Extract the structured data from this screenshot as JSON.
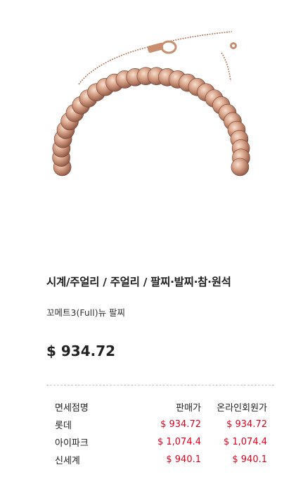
{
  "product": {
    "image_icon": "rose-gold-bead-bracelet-image",
    "category": "시계/주얼리 / 주얼리 / 팔찌·발찌·참·원석",
    "name": "꼬메트3(Full)뉴 팔찌",
    "price": "$ 934.72"
  },
  "price_table": {
    "headers": {
      "store": "면세점명",
      "sale": "판매가",
      "online": "온라인회원가"
    },
    "rows": [
      {
        "store": "롯데",
        "sale": "$ 934.72",
        "online": "$ 934.72"
      },
      {
        "store": "아이파크",
        "sale": "$ 1,074.4",
        "online": "$ 1,074.4"
      },
      {
        "store": "신세계",
        "sale": "$ 940.1",
        "online": "$ 940.1"
      }
    ]
  },
  "colors": {
    "price_red": "#e3001b",
    "metal": "#c98e6f"
  }
}
